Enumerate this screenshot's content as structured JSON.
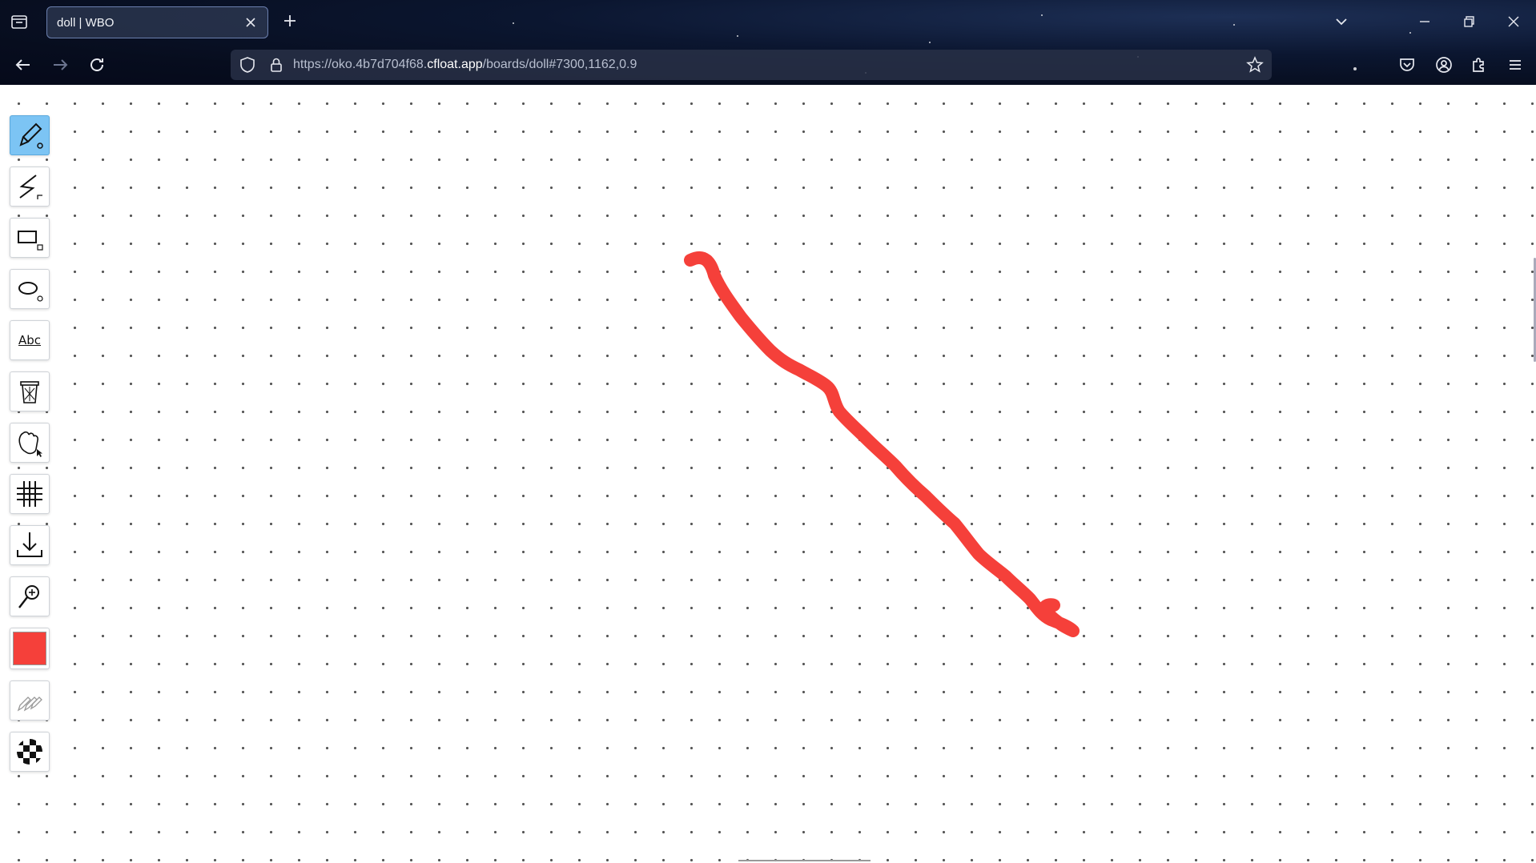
{
  "browser": {
    "tab_title": "doll | WBO",
    "url_prefix": "https://oko.4b7d704f68.",
    "url_host": "cfloat.app",
    "url_path": "/boards/doll#7300,1162,0.9"
  },
  "toolbar": {
    "tools": [
      {
        "name": "pencil",
        "icon": "pencil-icon",
        "active": true
      },
      {
        "name": "straight-line",
        "icon": "line-icon",
        "active": false
      },
      {
        "name": "rectangle",
        "icon": "rectangle-icon",
        "active": false
      },
      {
        "name": "ellipse",
        "icon": "ellipse-icon",
        "active": false
      },
      {
        "name": "text",
        "icon": "text-icon",
        "active": false
      },
      {
        "name": "eraser",
        "icon": "trash-icon",
        "active": false
      },
      {
        "name": "hand",
        "icon": "hand-icon",
        "active": false
      },
      {
        "name": "grid",
        "icon": "grid-icon",
        "active": false
      },
      {
        "name": "download",
        "icon": "download-icon",
        "active": false
      },
      {
        "name": "zoom",
        "icon": "zoom-icon",
        "active": false
      },
      {
        "name": "color",
        "icon": "color-swatch",
        "active": false
      },
      {
        "name": "size",
        "icon": "pencils-icon",
        "active": false
      },
      {
        "name": "opacity",
        "icon": "checker-icon",
        "active": false
      }
    ],
    "text_tool_label": "Abc",
    "current_color": "#f5403a"
  },
  "drawing": {
    "stroke_color": "#f5403a",
    "grid_style": "dots"
  }
}
